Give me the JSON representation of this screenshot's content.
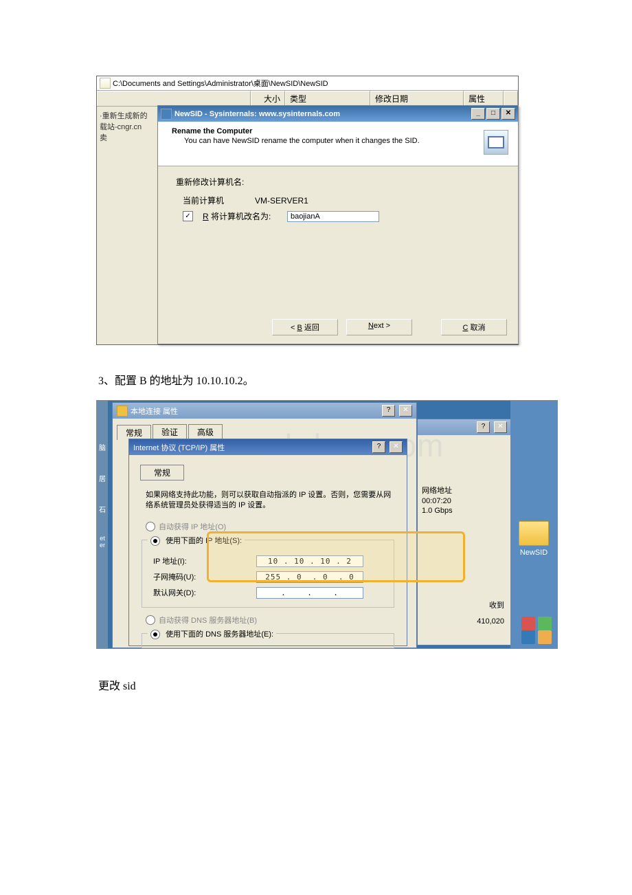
{
  "shot1": {
    "address_path": "C:\\Documents and Settings\\Administrator\\桌面\\NewSID\\NewSID",
    "columns": {
      "size": "大小",
      "type": "类型",
      "date": "修改日期",
      "attrs": "属性"
    },
    "leftpane": {
      "l1": "·重新生成新的",
      "l2": "载站-cngr.cn",
      "l3": "卖"
    },
    "wizard_title": "NewSID - Sysinternals: www.sysinternals.com",
    "head_title": "Rename the Computer",
    "head_sub": "You can have NewSID rename the computer when it changes the SID.",
    "body_title": "重新修改计算机名:",
    "current_label": "当前计算机",
    "current_value": "VM-SERVER1",
    "rename_label": "R 将计算机改名为:",
    "rename_value": "baojianA",
    "back": "< B 返回",
    "next": "Next >",
    "cancel": "C 取消"
  },
  "step_text": "3、配置 B 的地址为 10.10.10.2。",
  "shot2": {
    "win1_title": "本地连接 属性",
    "tabs": {
      "t1": "常规",
      "t2": "验证",
      "t3": "高级"
    },
    "win2_title": "Internet 协议 (TCP/IP) 属性",
    "tab_general": "常规",
    "hint": "如果网络支持此功能，则可以获取自动指派的 IP 设置。否则，您需要从网络系统管理员处获得适当的 IP 设置。",
    "r_auto_ip": "自动获得 IP 地址(O)",
    "r_manual_ip": "使用下面的 IP 地址(S):",
    "ip_label": "IP 地址(I):",
    "ip_value": "10 . 10 . 10 . 2",
    "mask_label": "子网掩码(U):",
    "mask_value": "255 . 0  . 0  . 0",
    "gw_label": "默认网关(D):",
    "gw_value": " .    .    . ",
    "r_auto_dns": "自动获得 DNS 服务器地址(B)",
    "r_manual_dns": "使用下面的 DNS 服务器地址(E):",
    "net_hdr": "网络地址",
    "mac": "00:07:20",
    "speed": "1.0 Gbps",
    "recv": "收到",
    "bytes": "410,020",
    "folder": "NewSID"
  },
  "watermark": "www.bdocx.com",
  "footer": "更改 sid"
}
